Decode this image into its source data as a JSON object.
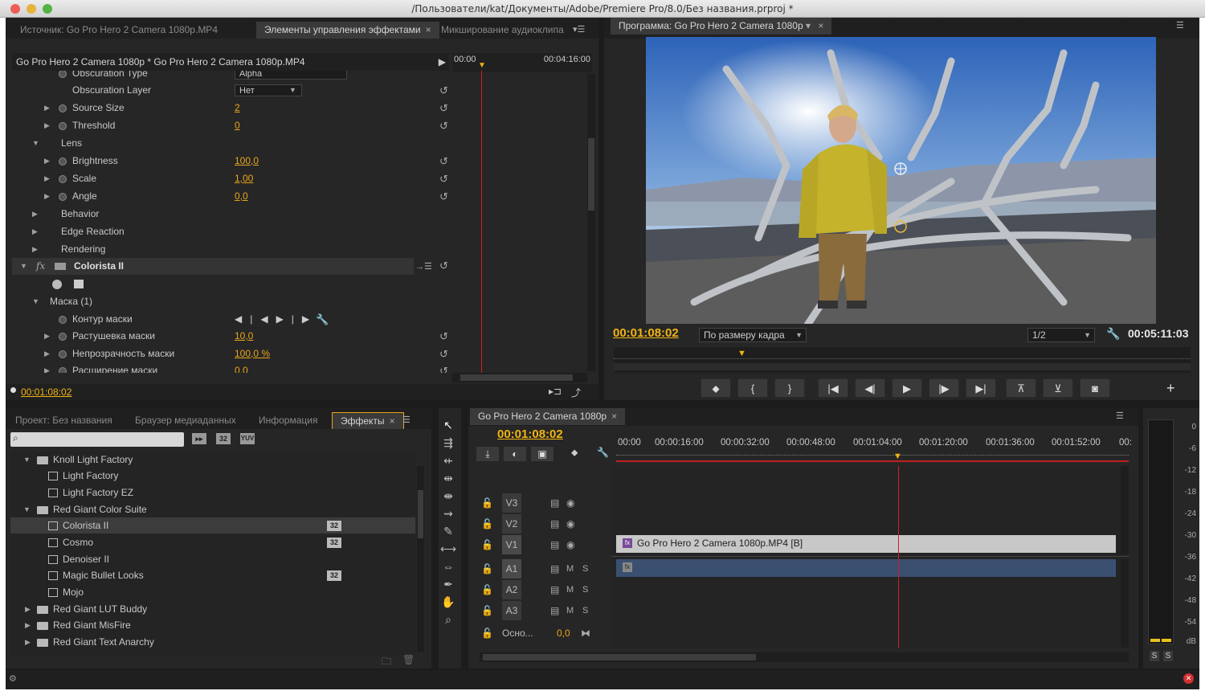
{
  "window": {
    "title": "/Пользователи/kat/Документы/Adobe/Premiere Pro/8.0/Без названия.prproj *"
  },
  "top_left_tabs": [
    {
      "label": "Источник: Go Pro Hero 2 Camera 1080p.MP4"
    },
    {
      "label": "Элементы управления эффектами",
      "close": "×"
    },
    {
      "label": "Микширование аудиоклипа"
    }
  ],
  "effect_controls": {
    "clip_path": "Go Pro Hero 2 Camera 1080p * Go Pro Hero 2 Camera 1080p.MP4",
    "time_start": "00:00",
    "time_end": "00:04:16:00",
    "rows": [
      {
        "label": "Obscuration Type",
        "value": "Alpha",
        "kind": "dropdown"
      },
      {
        "label": "Obscuration Layer",
        "value": "Нет",
        "kind": "dropdown"
      },
      {
        "label": "Source Size",
        "value": "2"
      },
      {
        "label": "Threshold",
        "value": "0"
      },
      {
        "label": "Lens"
      },
      {
        "label": "Brightness",
        "value": "100,0"
      },
      {
        "label": "Scale",
        "value": "1,00"
      },
      {
        "label": "Angle",
        "value": "0,0"
      },
      {
        "label": "Behavior"
      },
      {
        "label": "Edge Reaction"
      },
      {
        "label": "Rendering"
      },
      {
        "label": "Colorista II",
        "fx": "fx"
      },
      {
        "label": ""
      },
      {
        "label": "Маска (1)"
      },
      {
        "label": "Контур маски"
      },
      {
        "label": "Растушевка маски",
        "value": "10,0"
      },
      {
        "label": "Непрозрачность маски",
        "value": "100,0 %"
      },
      {
        "label": "Расширение маски",
        "value": "0,0"
      }
    ],
    "timecode": "00:01:08:02"
  },
  "program_monitor": {
    "tab": "Программа: Go Pro Hero 2 Camera 1080p",
    "timecode": "00:01:08:02",
    "fit": "По размеру кадра",
    "resolution": "1/2",
    "duration": "00:05:11:03",
    "transport": [
      "marker",
      "in",
      "out",
      "go-in",
      "step-back",
      "play",
      "step-forward",
      "go-out",
      "lift",
      "extract",
      "export-frame"
    ]
  },
  "bottom_left_tabs": [
    {
      "label": "Проект: Без названия"
    },
    {
      "label": "Браузер медиаданных"
    },
    {
      "label": "Информация"
    },
    {
      "label": "Эффекты",
      "close": "×"
    }
  ],
  "effects_panel": {
    "search_placeholder": "",
    "filter_labels": [
      "32",
      "YUV"
    ],
    "items": [
      {
        "label": "Knoll Light Factory",
        "type": "folder",
        "open": true
      },
      {
        "label": "Light Factory",
        "type": "effect"
      },
      {
        "label": "Light Factory EZ",
        "type": "effect"
      },
      {
        "label": "Red Giant Color Suite",
        "type": "folder",
        "open": true
      },
      {
        "label": "Colorista II",
        "type": "effect",
        "badge": "32",
        "selected": true
      },
      {
        "label": "Cosmo",
        "type": "effect",
        "badge": "32"
      },
      {
        "label": "Denoiser II",
        "type": "effect"
      },
      {
        "label": "Magic Bullet Looks",
        "type": "effect",
        "badge": "32"
      },
      {
        "label": "Mojo",
        "type": "effect"
      },
      {
        "label": "Red Giant LUT Buddy",
        "type": "folder",
        "open": false
      },
      {
        "label": "Red Giant MisFire",
        "type": "folder",
        "open": false
      },
      {
        "label": "Red Giant Text Anarchy",
        "type": "folder",
        "open": false
      }
    ]
  },
  "timeline": {
    "tab": "Go Pro Hero 2 Camera 1080p",
    "close": "×",
    "timecode": "00:01:08:02",
    "ruler": [
      "00:00",
      "00:00:16:00",
      "00:00:32:00",
      "00:00:48:00",
      "00:01:04:00",
      "00:01:20:00",
      "00:01:36:00",
      "00:01:52:00",
      "00:"
    ],
    "tracks": [
      {
        "name": "V3",
        "type": "video"
      },
      {
        "name": "V2",
        "type": "video"
      },
      {
        "name": "V1",
        "type": "video"
      },
      {
        "name": "A1",
        "type": "audio",
        "m": "M",
        "s": "S"
      },
      {
        "name": "A2",
        "type": "audio",
        "m": "M",
        "s": "S"
      },
      {
        "name": "A3",
        "type": "audio",
        "m": "M",
        "s": "S"
      }
    ],
    "master": {
      "label": "Осно...",
      "value": "0,0"
    },
    "clip_label": "Go Pro Hero 2 Camera 1080p.MP4 [В]"
  },
  "audio_meter": {
    "scale": [
      "0",
      "-6",
      "-12",
      "-18",
      "-24",
      "-30",
      "-36",
      "-42",
      "-48",
      "-54",
      "dB"
    ],
    "solo": [
      "S",
      "S"
    ]
  },
  "colors": {
    "accent": "#f0b413",
    "playhead": "#d02020",
    "panel": "#262626"
  }
}
